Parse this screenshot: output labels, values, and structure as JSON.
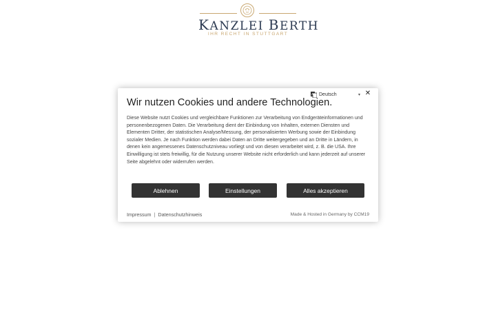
{
  "header": {
    "brand_first_cap": "K",
    "brand_first_rest": "ANZLEI",
    "brand_second_cap": "B",
    "brand_second_rest": "ERTH",
    "tagline": "IHR RECHT IN STUTTGART",
    "accent_color": "#c9a770",
    "brand_color": "#2d3b52"
  },
  "cookie_dialog": {
    "language": {
      "icon": "language-icon",
      "selected": "Deutsch"
    },
    "close_icon": "close-icon",
    "title": "Wir nutzen Cookies und andere Technologien.",
    "body": "Diese Website nutzt Cookies und vergleichbare Funktionen zur Verarbeitung von Endgeräteinformationen und personenbezogenen Daten. Die Verarbeitung dient der Einbindung von Inhalten, externen Diensten und Elementen Dritter, der statistischen Analyse/Messung, der personalisierten Werbung sowie der Einbindung sozialer Medien. Je nach Funktion werden dabei Daten an Dritte weitergegeben und an Dritte in Ländern, in denen kein angemessenes Datenschutzniveau vorliegt und von diesen verarbeitet wird, z. B. die USA. Ihre Einwilligung ist stets freiwillig, für die Nutzung unserer Website nicht erforderlich und kann jederzeit auf unserer Seite abgelehnt oder widerrufen werden.",
    "buttons": {
      "reject": "Ablehnen",
      "settings": "Einstellungen",
      "accept": "Alles akzeptieren"
    },
    "footer": {
      "imprint": "Impressum",
      "separator": "|",
      "privacy": "Datenschutzhinweis",
      "credit": "Made & Hosted in Germany by CCM19"
    },
    "button_color": "#333333"
  }
}
